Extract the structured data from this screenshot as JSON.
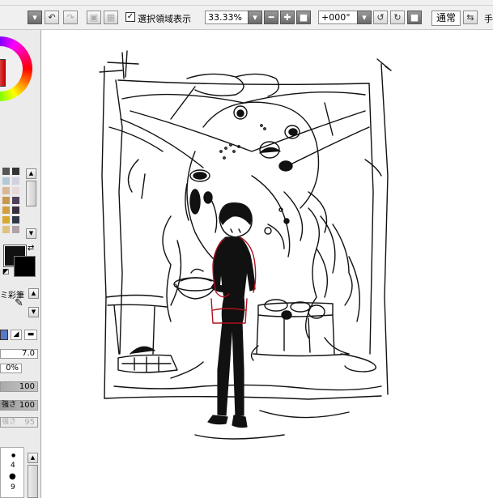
{
  "toolbar": {
    "selection_checkbox_label": "選択領域表示",
    "selection_checked": true,
    "zoom_value": "33.33%",
    "rotation_value": "+000°",
    "blend_mode": "通常",
    "truncated_label": "手"
  },
  "left_panel": {
    "mixing_label": "ミ彩筆",
    "size_value": "7.0",
    "density_value": "0%",
    "slider_1_value": "100",
    "slider_2_label": "強さ",
    "slider_2_value": "100",
    "slider_3_label": "強さ",
    "slider_3_value": "95",
    "brush_sizes": [
      "4",
      "9"
    ]
  },
  "colors": {
    "fg": "#111111",
    "bg": "#000000",
    "accent_red": "#b01020"
  }
}
